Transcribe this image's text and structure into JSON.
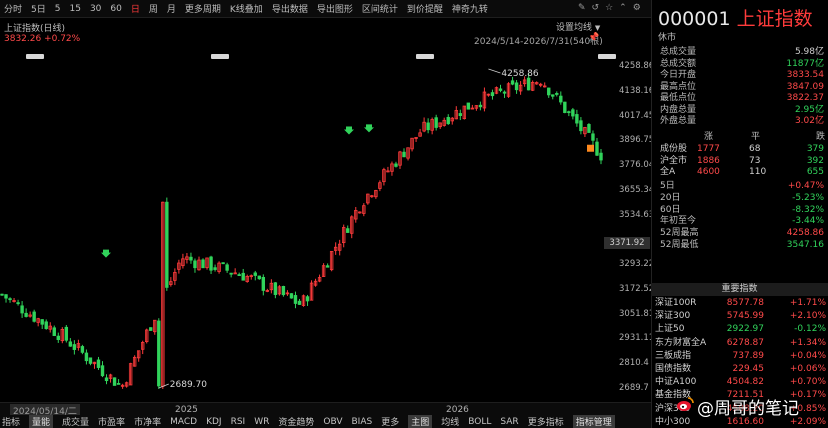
{
  "toolbar": {
    "items": [
      "分时",
      "5日",
      "5",
      "15",
      "30",
      "60",
      "日",
      "周",
      "月",
      "更多周期",
      "K线叠加",
      "导出数据",
      "导出图形",
      "区间统计",
      "到价提醒",
      "神奇九转"
    ],
    "active": "日",
    "icons": [
      "pen-icon",
      "restore-icon",
      "star-icon",
      "chevron-up-icon",
      "settings-icon"
    ]
  },
  "chart": {
    "title": "上证指数(日线)",
    "quote": "3832.26 +0.72%",
    "settings_label": "设置均线",
    "date_range": "2024/5/14-2026/7/31(540根)",
    "current_price_tag": "3371.92",
    "xaxis": {
      "cursor_date": "2024/05/14/二",
      "labels": [
        "2025",
        "2026"
      ]
    }
  },
  "chart_data": {
    "type": "candlestick",
    "title": "上证指数(日线)",
    "y_ticks": [
      4258.86,
      4138.16,
      4017.45,
      3896.75,
      3776.04,
      3655.34,
      3534.63,
      3413.93,
      3293.22,
      3172.52,
      3051.81,
      2931.11,
      2810.4,
      2689.7
    ],
    "ylim": [
      2689.7,
      4258.86
    ],
    "x_tick_labels": [
      "2025",
      "2026"
    ],
    "annotations": [
      {
        "label": "4258.86",
        "kind": "period-high"
      },
      {
        "label": "2689.70",
        "kind": "period-low"
      }
    ],
    "key_closes_approx": [
      {
        "x": "2024-05",
        "close": 3150
      },
      {
        "x": "2024-07",
        "close": 2950
      },
      {
        "x": "2024-09",
        "close": 2700
      },
      {
        "x": "2024-10",
        "close": 3330
      },
      {
        "x": "2025-01",
        "close": 3250
      },
      {
        "x": "2025-04",
        "close": 3100
      },
      {
        "x": "2025-07",
        "close": 3600
      },
      {
        "x": "2025-10",
        "close": 3950
      },
      {
        "x": "2026-01",
        "close": 4100
      },
      {
        "x": "2026-04",
        "close": 4200
      },
      {
        "x": "2026-07",
        "close": 3832.26
      }
    ]
  },
  "bottom_bar": {
    "items": [
      "指标",
      "量能",
      "成交量",
      "市盈率",
      "市净率",
      "MACD",
      "KDJ",
      "RSI",
      "WR",
      "资金趋势",
      "OBV",
      "BIAS",
      "更多",
      "主图",
      "均线",
      "BOLL",
      "SAR",
      "更多指标",
      "指标管理"
    ]
  },
  "panel": {
    "code": "000001",
    "name": "上证指数",
    "status": "休市",
    "stats": [
      {
        "label": "总成交量",
        "value": "5.98亿",
        "color": "white"
      },
      {
        "label": "总成交额",
        "value": "11877亿",
        "color": "green"
      },
      {
        "label": "今日开盘",
        "value": "3833.54",
        "color": "red"
      },
      {
        "label": "最高点位",
        "value": "3847.09",
        "color": "red"
      },
      {
        "label": "最低点位",
        "value": "3822.37",
        "color": "red"
      },
      {
        "label": "内盘总量",
        "value": "2.95亿",
        "color": "green"
      },
      {
        "label": "外盘总量",
        "value": "3.02亿",
        "color": "red"
      }
    ],
    "breadth_header": [
      "涨",
      "平",
      "跌"
    ],
    "breadth": [
      {
        "label": "成份股",
        "up": "1777",
        "flat": "68",
        "down": "379"
      },
      {
        "label": "沪全市",
        "up": "1886",
        "flat": "73",
        "down": "392"
      },
      {
        "label": "全A",
        "up": "4600",
        "flat": "110",
        "down": "655"
      }
    ],
    "periods": [
      {
        "label": "5日",
        "value": "+0.47%",
        "color": "red"
      },
      {
        "label": "20日",
        "value": "-5.23%",
        "color": "green"
      },
      {
        "label": "60日",
        "value": "-8.32%",
        "color": "green"
      },
      {
        "label": "年初至今",
        "value": "-3.44%",
        "color": "green"
      },
      {
        "label": "52周最高",
        "value": "4258.86",
        "color": "red"
      },
      {
        "label": "52周最低",
        "value": "3547.16",
        "color": "green"
      }
    ],
    "indices_title": "重要指数",
    "indices": [
      {
        "name": "深证100R",
        "price": "8577.78",
        "change": "+1.71%",
        "color": "red"
      },
      {
        "name": "深证300",
        "price": "5745.99",
        "change": "+2.10%",
        "color": "red"
      },
      {
        "name": "上证50",
        "price": "2922.97",
        "change": "-0.12%",
        "color": "green"
      },
      {
        "name": "东方财富全A",
        "price": "6278.87",
        "change": "+1.34%",
        "color": "red"
      },
      {
        "name": "三板成指",
        "price": "737.89",
        "change": "+0.04%",
        "color": "red"
      },
      {
        "name": "国债指数",
        "price": "229.45",
        "change": "+0.06%",
        "color": "red"
      },
      {
        "name": "中证A100",
        "price": "4504.82",
        "change": "+0.70%",
        "color": "red"
      },
      {
        "name": "基金指数",
        "price": "7211.51",
        "change": "+0.17%",
        "color": "red"
      },
      {
        "name": "沪深300",
        "price": "4588.20",
        "change": "+0.85%",
        "color": "red"
      },
      {
        "name": "中小300",
        "price": "1616.60",
        "change": "+2.09%",
        "color": "red"
      }
    ]
  },
  "watermark": "@周哥的笔记",
  "colors": {
    "up": "#ff3b3b",
    "down": "#31d35b",
    "background": "#000000",
    "accent": "#ff3b3b"
  }
}
